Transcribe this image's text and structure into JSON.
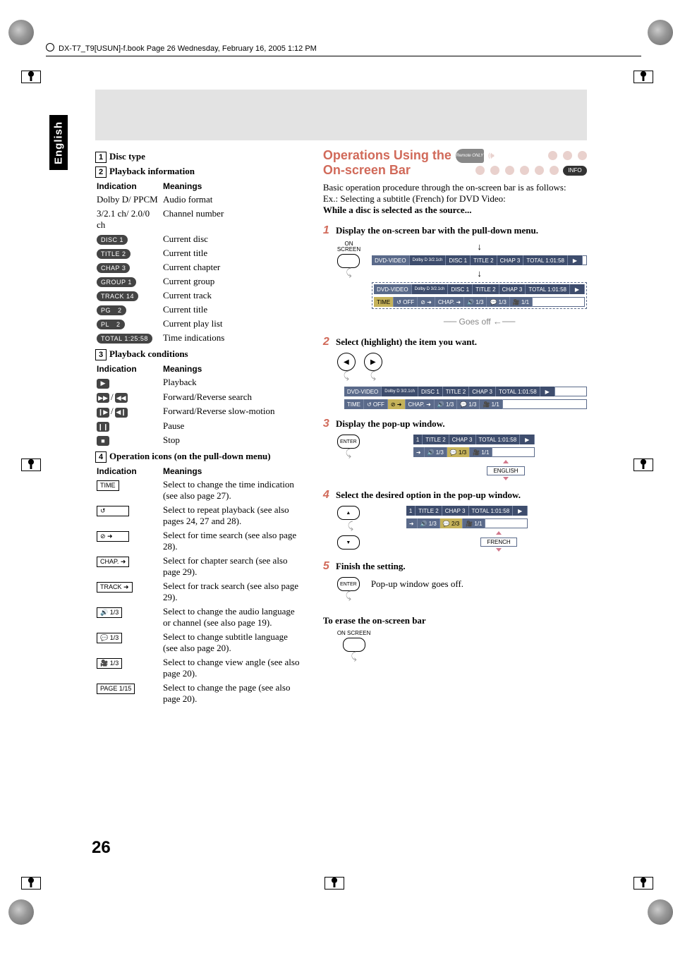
{
  "header": "DX-T7_T9[USUN]-f.book  Page 26  Wednesday, February 16, 2005  1:12 PM",
  "side_tab": "English",
  "page_number": "26",
  "left": {
    "s1": {
      "num": "1",
      "title": "Disc type"
    },
    "s2": {
      "num": "2",
      "title": "Playback information",
      "h1": "Indication",
      "h2": "Meanings",
      "rows": [
        {
          "ind": "Dolby D/ PPCM",
          "mean": "Audio format",
          "type": "text"
        },
        {
          "ind": "3/2.1 ch/ 2.0/0 ch",
          "mean": "Channel number",
          "type": "text"
        },
        {
          "ind": "DISC  1",
          "mean": "Current disc",
          "type": "pill"
        },
        {
          "ind": "TITLE  2",
          "mean": "Current title",
          "type": "pill"
        },
        {
          "ind": "CHAP  3",
          "mean": "Current chapter",
          "type": "pill"
        },
        {
          "ind": "GROUP 1",
          "mean": "Current group",
          "type": "pill"
        },
        {
          "ind": "TRACK 14",
          "mean": "Current track",
          "type": "pill"
        },
        {
          "ind": "PG|2",
          "mean": "Current title",
          "type": "pill-gap"
        },
        {
          "ind": "PL|2",
          "mean": "Current play list",
          "type": "pill-gap"
        },
        {
          "ind": "TOTAL 1:25:58",
          "mean": "Time indications",
          "type": "pill"
        }
      ]
    },
    "s3": {
      "num": "3",
      "title": "Playback conditions",
      "h1": "Indication",
      "h2": "Meanings",
      "rows": [
        {
          "icons": [
            "▶"
          ],
          "mean": "Playback"
        },
        {
          "icons": [
            "▶▶",
            "/",
            "◀◀"
          ],
          "mean": "Forward/Reverse search"
        },
        {
          "icons": [
            "❙▶",
            "/",
            "◀❙"
          ],
          "mean": "Forward/Reverse slow-motion"
        },
        {
          "icons": [
            "❙❙"
          ],
          "mean": "Pause"
        },
        {
          "icons": [
            "■"
          ],
          "mean": "Stop"
        }
      ]
    },
    "s4": {
      "num": "4",
      "title": "Operation icons (on the pull-down menu)",
      "h1": "Indication",
      "h2": "Meanings",
      "rows": [
        {
          "label": "TIME",
          "mean": "Select to change the time indication (see also page 27)."
        },
        {
          "label": "↺",
          "mean": "Select to repeat playback (see also pages 24, 27 and 28)."
        },
        {
          "label": "⊘ ➜",
          "mean": "Select for time search (see also page 28)."
        },
        {
          "label": "CHAP. ➜",
          "mean": "Select for chapter search (see also page 29)."
        },
        {
          "label": "TRACK ➜",
          "mean": "Select for track search (see also page 29)."
        },
        {
          "label": "🔊 1/3",
          "mean": "Select to change the audio language or channel (see also page 19)."
        },
        {
          "label": "💬 1/3",
          "mean": "Select to change subtitle language (see also page 20)."
        },
        {
          "label": "🎥 1/3",
          "mean": "Select to change view angle (see also page 20)."
        },
        {
          "label": "PAGE 1/15",
          "mean": "Select to change the page (see also page 20)."
        }
      ]
    }
  },
  "right": {
    "title1": "Operations Using the",
    "title2": "On-screen Bar",
    "remote": "Remote ONLY",
    "info": "INFO",
    "intro1": "Basic operation procedure through the on-screen bar is as follows:",
    "intro2": "Ex.: Selecting a subtitle (French) for DVD Video:",
    "intro3": "While a disc is selected as the source...",
    "btn_onscreen": "ON SCREEN",
    "btn_enter": "ENTER",
    "goesoff": "Goes off",
    "steps": [
      {
        "n": "1",
        "t": "Display the on-screen bar with the pull-down menu."
      },
      {
        "n": "2",
        "t": "Select (highlight) the item you want."
      },
      {
        "n": "3",
        "t": "Display the pop-up window."
      },
      {
        "n": "4",
        "t": "Select the desired option in the pop-up window."
      },
      {
        "n": "5",
        "t": "Finish the setting."
      }
    ],
    "osd_top": {
      "fmt": "DVD-VIDEO",
      "dd": "Dolby D 3/2.1ch",
      "disc": "DISC 1",
      "title": "TITLE  2",
      "chap": "CHAP  3",
      "total": "TOTAL  1:01:58"
    },
    "osd_bot": {
      "time": "TIME",
      "off": "↺ OFF",
      "ts": "⊘ ➜",
      "cs": "CHAP. ➜",
      "au": "🔊 1/3",
      "su": "💬 1/3",
      "an": "🎥 1/1"
    },
    "popup3": {
      "su": "💬 1/3",
      "lang": "ENGLISH"
    },
    "popup4": {
      "su": "💬 2/3",
      "lang": "FRENCH"
    },
    "step5_text": "Pop-up window goes off.",
    "erase": "To erase the on-screen bar"
  }
}
